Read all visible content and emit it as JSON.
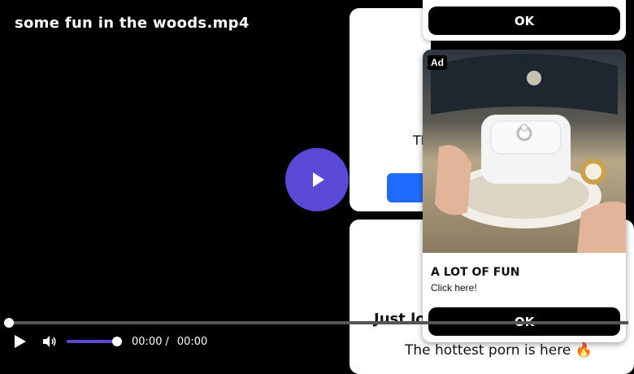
{
  "player": {
    "title": "some fun in the woods.mp4",
    "current_time": "00:00",
    "separator": "/",
    "duration": "00:00",
    "progress_fraction": 0,
    "volume_fraction": 1,
    "accent_color": "#5a48d6"
  },
  "card_top": {
    "text_fragment": "Th"
  },
  "card_bottom": {
    "heading": "Just loo",
    "subtext": "The hottest porn is here 🔥"
  },
  "ad_top": {
    "ok_label": "OK"
  },
  "ad_main": {
    "badge": "Ad",
    "title": "A LOT OF FUN",
    "subtitle": "Click here!",
    "ok_label": "OK"
  }
}
